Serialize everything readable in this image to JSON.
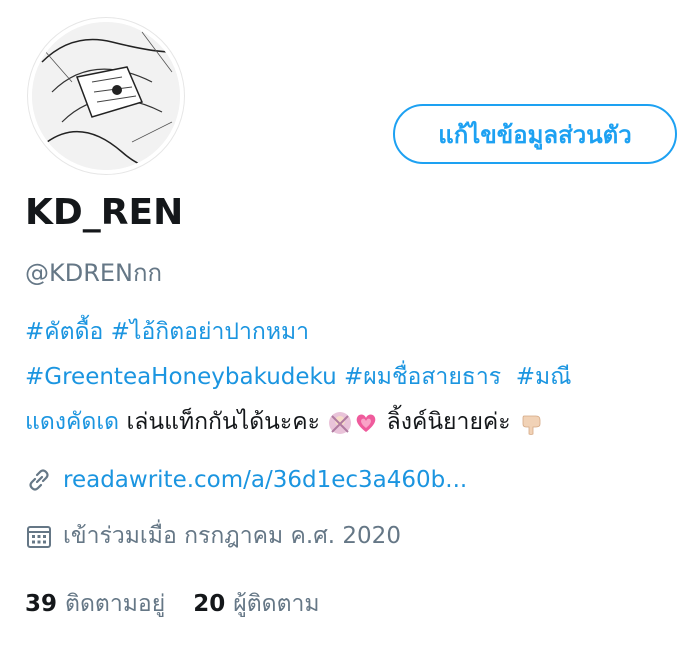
{
  "profile": {
    "edit_button": "แก้ไขข้อมูลส่วนตัว",
    "display_name": "KD_REN",
    "handle": "@KDRENกก",
    "bio": {
      "line1_tags": [
        "#คัตดื้อ",
        "#ไอ้กิตอย่าปากหมา"
      ],
      "line2_tags": [
        "#GreenteaHoneybakudeku",
        "#ผมชื่อสายธาร",
        "#มณี"
      ],
      "line3_tag": "แดงคัดเด",
      "line3_text": "เล่นแท็กกันได้นะคะ",
      "line3_text2": "ลิ้งค์นิยายค่ะ"
    },
    "link": "readawrite.com/a/36d1ec3a460b...",
    "joined": "เข้าร่วมเมื่อ กรกฎาคม ค.ศ. 2020",
    "following_count": "39",
    "following_label": "ติดตามอยู่",
    "followers_count": "20",
    "followers_label": "ผู้ติดตาม"
  },
  "colors": {
    "accent": "#1da1f2",
    "link": "#1b95e0",
    "secondary": "#657786"
  }
}
